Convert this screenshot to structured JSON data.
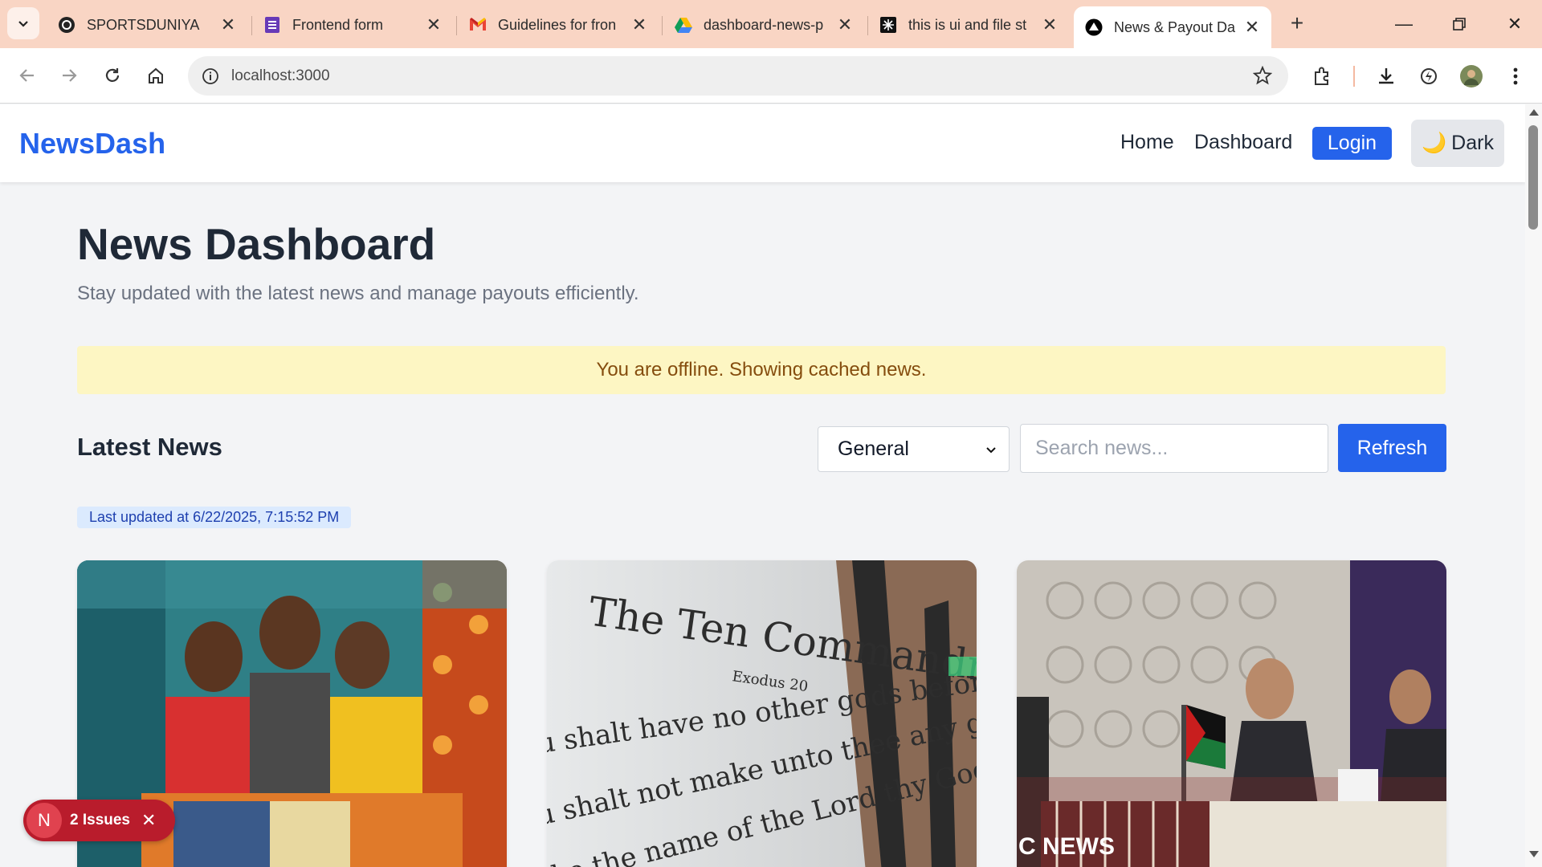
{
  "browser": {
    "tabs": [
      {
        "title": "SPORTSDUNIYA",
        "icon": "sportsduniya-icon"
      },
      {
        "title": "Frontend form",
        "icon": "forms-icon"
      },
      {
        "title": "Guidelines for fron",
        "icon": "gmail-icon"
      },
      {
        "title": "dashboard-news-p",
        "icon": "drive-icon"
      },
      {
        "title": "this is ui and file st",
        "icon": "site-icon"
      },
      {
        "title": "News & Payout Da",
        "icon": "vercel-icon",
        "active": true
      }
    ],
    "url": "localhost:3000"
  },
  "app": {
    "brand": "NewsDash",
    "nav": {
      "home": "Home",
      "dashboard": "Dashboard",
      "login": "Login",
      "theme": "Dark",
      "theme_icon": "🌙"
    },
    "title": "News Dashboard",
    "subtitle": "Stay updated with the latest news and manage payouts efficiently.",
    "offline_notice": "You are offline. Showing cached news.",
    "section_title": "Latest News",
    "category": {
      "selected": "General"
    },
    "search": {
      "placeholder": "Search news..."
    },
    "refresh_label": "Refresh",
    "last_updated": "Last updated at 6/22/2025, 7:15:52 PM",
    "card3_watermark": "C NEWS"
  },
  "devtools": {
    "badge_letter": "N",
    "issues": "2 Issues"
  },
  "colors": {
    "brand": "#2563eb",
    "offline_bg": "#fdf6c3",
    "offline_text": "#854d0e",
    "issues_badge": "#b91c2c",
    "tabbar": "#f9d5c4"
  }
}
